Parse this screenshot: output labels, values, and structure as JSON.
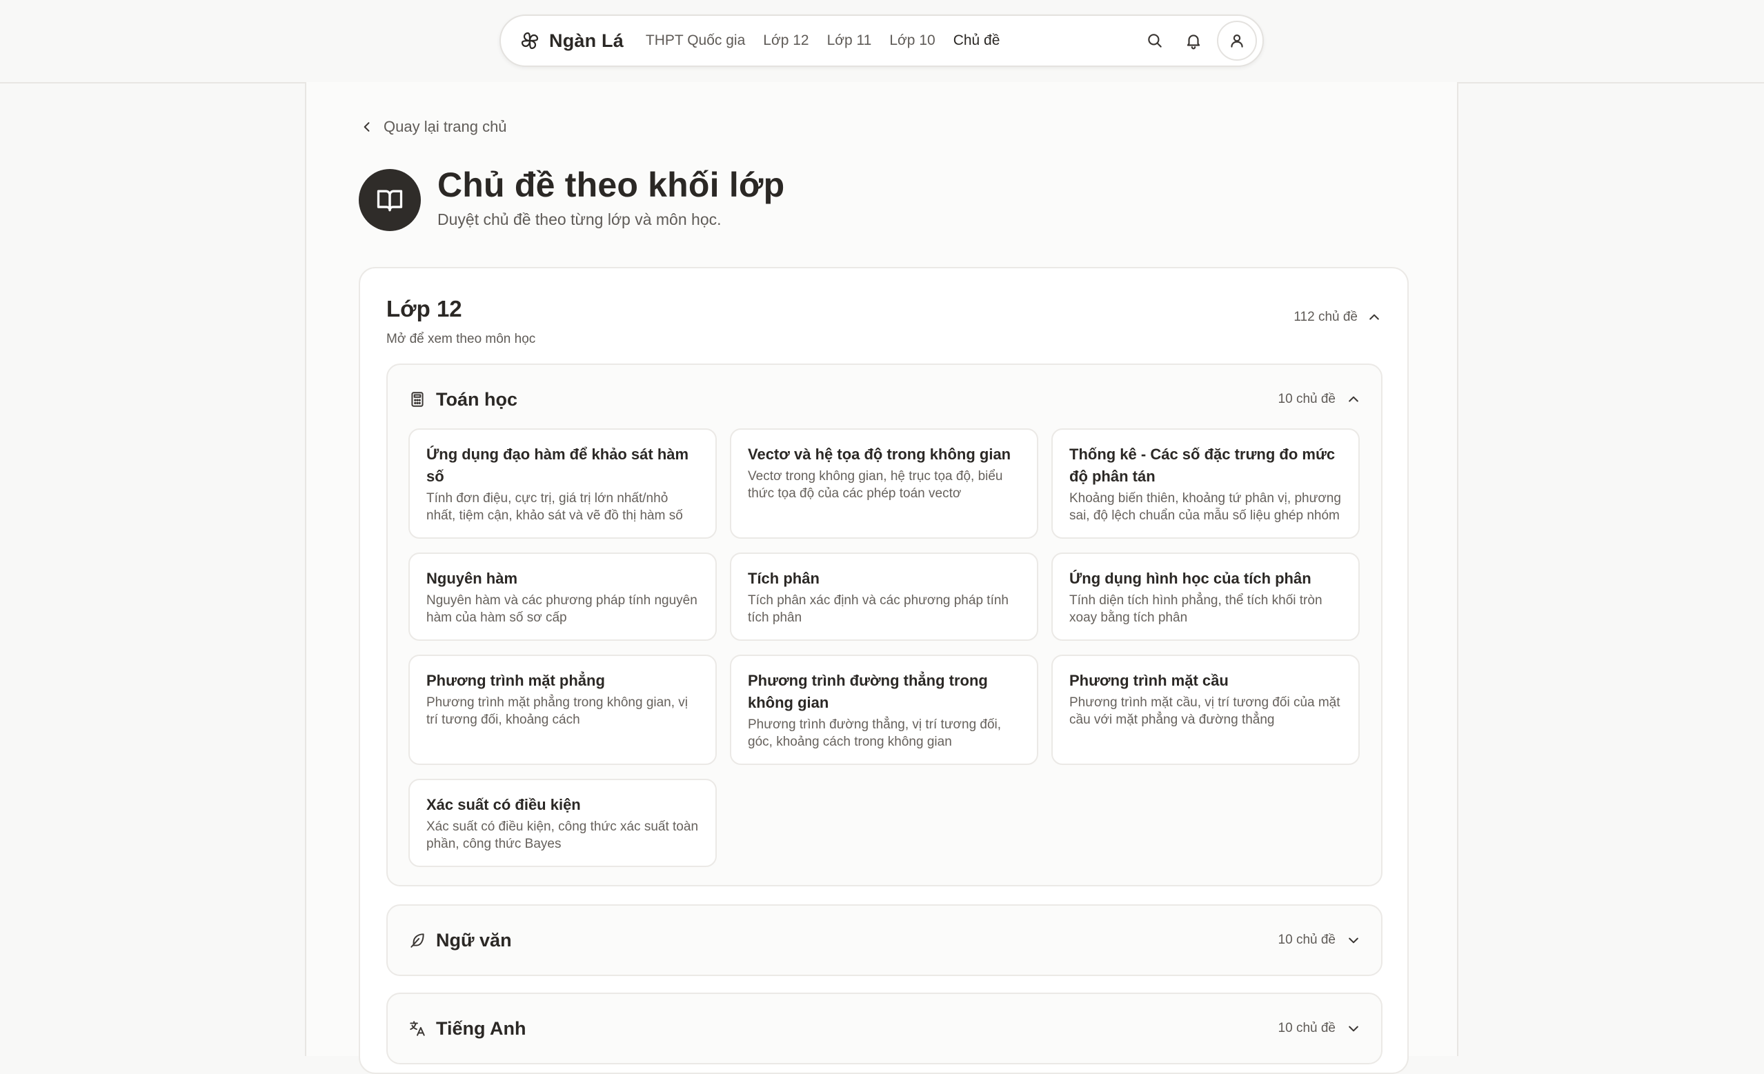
{
  "nav": {
    "brand": "Ngàn Lá",
    "links": [
      {
        "label": "THPT Quốc gia"
      },
      {
        "label": "Lớp 12"
      },
      {
        "label": "Lớp 11"
      },
      {
        "label": "Lớp 10"
      },
      {
        "label": "Chủ đề",
        "active": true
      }
    ],
    "icons": [
      "search-icon",
      "bell-icon",
      "user-icon"
    ]
  },
  "back_link": "Quay lại trang chủ",
  "page": {
    "title": "Chủ đề theo khối lớp",
    "subtitle": "Duyệt chủ đề theo từng lớp và môn học.",
    "icon": "open-book-icon"
  },
  "grade": {
    "title": "Lớp 12",
    "subtitle": "Mở để xem theo môn học",
    "count": "112 chủ đề",
    "expanded": true
  },
  "subjects": [
    {
      "name": "Toán học",
      "icon": "calculator-icon",
      "count": "10 chủ đề",
      "expanded": true,
      "topics": [
        {
          "title": "Ứng dụng đạo hàm để khảo sát hàm số",
          "desc": "Tính đơn điệu, cực trị, giá trị lớn nhất/nhỏ nhất, tiệm cận, khảo sát và vẽ đồ thị hàm số"
        },
        {
          "title": "Vectơ và hệ tọa độ trong không gian",
          "desc": "Vectơ trong không gian, hệ trục tọa độ, biểu thức tọa độ của các phép toán vectơ"
        },
        {
          "title": "Thống kê - Các số đặc trưng đo mức độ phân tán",
          "desc": "Khoảng biến thiên, khoảng tứ phân vị, phương sai, độ lệch chuẩn của mẫu số liệu ghép nhóm"
        },
        {
          "title": "Nguyên hàm",
          "desc": "Nguyên hàm và các phương pháp tính nguyên hàm của hàm số sơ cấp"
        },
        {
          "title": "Tích phân",
          "desc": "Tích phân xác định và các phương pháp tính tích phân"
        },
        {
          "title": "Ứng dụng hình học của tích phân",
          "desc": "Tính diện tích hình phẳng, thể tích khối tròn xoay bằng tích phân"
        },
        {
          "title": "Phương trình mặt phẳng",
          "desc": "Phương trình mặt phẳng trong không gian, vị trí tương đối, khoảng cách"
        },
        {
          "title": "Phương trình đường thẳng trong không gian",
          "desc": "Phương trình đường thẳng, vị trí tương đối, góc, khoảng cách trong không gian"
        },
        {
          "title": "Phương trình mặt cầu",
          "desc": "Phương trình mặt cầu, vị trí tương đối của mặt cầu với mặt phẳng và đường thẳng"
        },
        {
          "title": "Xác suất có điều kiện",
          "desc": "Xác suất có điều kiện, công thức xác suất toàn phần, công thức Bayes"
        }
      ]
    },
    {
      "name": "Ngữ văn",
      "icon": "feather-icon",
      "count": "10 chủ đề",
      "expanded": false
    },
    {
      "name": "Tiếng Anh",
      "icon": "translate-icon",
      "count": "10 chủ đề",
      "expanded": false
    }
  ]
}
